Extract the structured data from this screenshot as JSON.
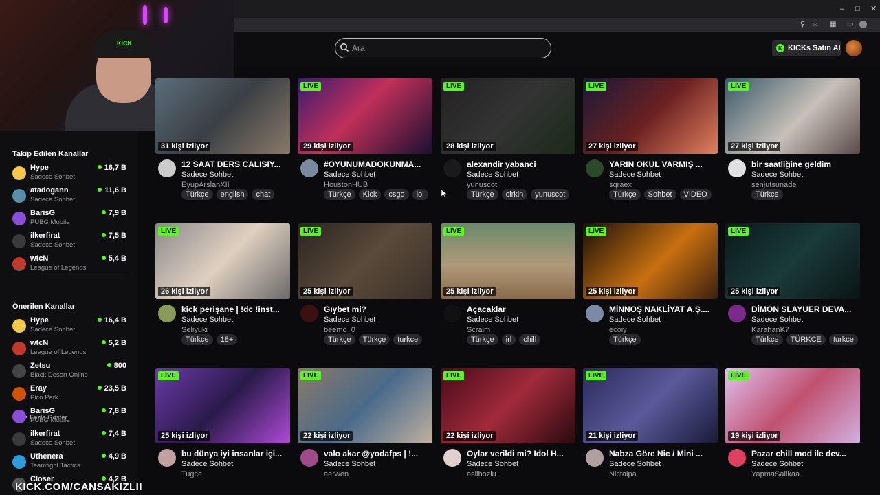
{
  "header": {
    "search_placeholder": "Ara",
    "kicks_button": "KICKs Satın Al"
  },
  "webcam": {
    "cap_text": "KICK"
  },
  "sidebar": {
    "followed_title": "Takip Edilen Kanallar",
    "followed": [
      {
        "name": "Hype",
        "category": "Sadece Sohbet",
        "viewers": "16,7 B",
        "color": "#f2c94c"
      },
      {
        "name": "atadogann",
        "category": "Sadece Sohbet",
        "viewers": "11,6 B",
        "color": "#5a8fa8"
      },
      {
        "name": "BarisG",
        "category": "PUBG Mobile",
        "viewers": "7,9 B",
        "color": "#8a4fd8"
      },
      {
        "name": "ilkerfirat",
        "category": "Sadece Sohbet",
        "viewers": "7,5 B",
        "color": "#3a3a3a"
      },
      {
        "name": "wtcN",
        "category": "League of Legends",
        "viewers": "5,4 B",
        "color": "#c0392b"
      }
    ],
    "more_label": "Daha Fazla Göster",
    "recommended_title": "Önerilen Kanallar",
    "recommended": [
      {
        "name": "Hype",
        "category": "Sadece Sohbet",
        "viewers": "16,4 B",
        "color": "#f2c94c"
      },
      {
        "name": "wtcN",
        "category": "League of Legends",
        "viewers": "5,2 B",
        "color": "#c0392b"
      },
      {
        "name": "Zetsu",
        "category": "Black Desert Online",
        "viewers": "800",
        "color": "#444"
      },
      {
        "name": "Eray",
        "category": "Pico Park",
        "viewers": "23,5 B",
        "color": "#d35400"
      },
      {
        "name": "BarisG",
        "category": "PUBG Mobile",
        "viewers": "7,8 B",
        "color": "#8a4fd8"
      },
      {
        "name": "ilkerfirat",
        "category": "Sadece Sohbet",
        "viewers": "7,4 B",
        "color": "#3a3a3a"
      },
      {
        "name": "Uthenera",
        "category": "Teamfight Tactics",
        "viewers": "4,9 B",
        "color": "#2d9cdb"
      },
      {
        "name": "Closer",
        "category": "",
        "viewers": "4,2 B",
        "color": "#555"
      }
    ]
  },
  "live_label": "LIVE",
  "streams": [
    {
      "viewers": "31 kişi izliyor",
      "title": "12 SAAT DERS CALISIY...",
      "category": "Sadece Sohbet",
      "user": "EyupArslanXII",
      "tags": [
        "Türkçe",
        "english",
        "chat"
      ],
      "live": false,
      "thumb": "linear-gradient(135deg,#5a6e7a,#3a3f44 50%,#8a7a6a)",
      "avatar": "#ccc"
    },
    {
      "viewers": "29 kişi izliyor",
      "title": "#OYUNUMADOKUNMA...",
      "category": "Sadece Sohbet",
      "user": "HoustonHUB",
      "tags": [
        "Türkçe",
        "Kick",
        "csgo",
        "lol"
      ],
      "live": true,
      "thumb": "linear-gradient(135deg,#3a1c6e,#c0305a 45%,#1a1030)",
      "avatar": "#7a8aa0"
    },
    {
      "viewers": "28 kişi izliyor",
      "title": "alexandir yabanci",
      "category": "Sadece Sohbet",
      "user": "yunuscot",
      "tags": [
        "Türkçe",
        "cirkin",
        "yunuscot"
      ],
      "live": true,
      "thumb": "linear-gradient(135deg,#222,#333 50%,#1a2a1a)",
      "avatar": "#1a1a1a"
    },
    {
      "viewers": "27 kişi izliyor",
      "title": "YARIN OKUL VARMIŞ ...",
      "category": "Sadece Sohbet",
      "user": "sqraex",
      "tags": [
        "Türkçe",
        "Sohbet",
        "VIDEO"
      ],
      "live": true,
      "thumb": "linear-gradient(135deg,#1a1a3a,#6a2020 50%,#e08060)",
      "avatar": "#2a4a2a"
    },
    {
      "viewers": "27 kişi izliyor",
      "title": "bir saatliğine geldim",
      "category": "Sadece Sohbet",
      "user": "senjutsunade",
      "tags": [
        "Türkçe"
      ],
      "live": true,
      "thumb": "linear-gradient(135deg,#3a5a6a,#c8c0b8 55%,#5a4a4a)",
      "avatar": "#e0e0e0"
    },
    {
      "viewers": "26 kişi izliyor",
      "title": "kick perişane | !dc !inst...",
      "category": "Sadece Sohbet",
      "user": "Seliyuki",
      "tags": [
        "Türkçe",
        "18+"
      ],
      "live": true,
      "thumb": "linear-gradient(135deg,#8a8a8a,#e0d0c0 50%,#6a6a6a)",
      "avatar": "#8a9a5a"
    },
    {
      "viewers": "25 kişi izliyor",
      "title": "Gıybet mi?",
      "category": "Sadece Sohbet",
      "user": "beemo_0",
      "tags": [
        "Türkçe",
        "Türkçe",
        "turkce"
      ],
      "live": true,
      "thumb": "linear-gradient(135deg,#2a2420,#5a4a3a 50%,#3a3028)",
      "avatar": "#3a1010"
    },
    {
      "viewers": "25 kişi izliyor",
      "title": "Açacaklar",
      "category": "Sadece Sohbet",
      "user": "Scraim",
      "tags": [
        "Türkçe",
        "irl",
        "chill"
      ],
      "live": true,
      "thumb": "linear-gradient(180deg,#6a8a6a,#b09a7a 55%,#8a6a4a)",
      "avatar": "#111"
    },
    {
      "viewers": "25 kişi izliyor",
      "title": "MİNNOŞ NAKLİYAT A.Ş....",
      "category": "Sadece Sohbet",
      "user": "ecoiy",
      "tags": [
        "Türkçe"
      ],
      "live": true,
      "thumb": "linear-gradient(135deg,#1a1008,#c87010 55%,#3a2010)",
      "avatar": "#7a8aa8"
    },
    {
      "viewers": "25 kişi izliyor",
      "title": "DİMON SLAYUER DEVA...",
      "category": "Sadece Sohbet",
      "user": "KarahanK7",
      "tags": [
        "Türkçe",
        "TÜRKCE",
        "turkce"
      ],
      "live": true,
      "thumb": "linear-gradient(135deg,#0a1a1a,#1a3a3a 50%,#0a1414)",
      "avatar": "#7a2a8a"
    },
    {
      "viewers": "25 kişi izliyor",
      "title": "bu dünya iyi insanlar içi...",
      "category": "Sadece Sohbet",
      "user": "Tugce",
      "tags": [],
      "live": true,
      "thumb": "linear-gradient(135deg,#6a3aa8,#2a1a4a 50%,#b04ad8)",
      "avatar": "#c0a0a0"
    },
    {
      "viewers": "22 kişi izliyor",
      "title": "valo akar @yodafps | !...",
      "category": "Sadece Sohbet",
      "user": "aerwen",
      "tags": [],
      "live": true,
      "thumb": "linear-gradient(135deg,#8a7a6a,#4a6a8a 50%,#c0b0a0)",
      "avatar": "#a04a8a"
    },
    {
      "viewers": "22 kişi izliyor",
      "title": "Oylar verildi mi? Idol H...",
      "category": "Sadece Sohbet",
      "user": "aslibozlu",
      "tags": [],
      "live": true,
      "thumb": "linear-gradient(135deg,#4a0a1a,#a02a3a 50%,#2a0a10)",
      "avatar": "#e0d0d0"
    },
    {
      "viewers": "21 kişi izliyor",
      "title": "Nabza Göre Nic / Mini ...",
      "category": "Sadece Sohbet",
      "user": "Nictalpa",
      "tags": [],
      "live": true,
      "thumb": "linear-gradient(135deg,#2a2a5a,#5a5a9a 50%,#1a1a3a)",
      "avatar": "#b0a0a0"
    },
    {
      "viewers": "19 kişi izliyor",
      "title": "Pazar chill mod ile dev...",
      "category": "Sadece Sohbet",
      "user": "YapmaSalikaa",
      "tags": [],
      "live": true,
      "thumb": "linear-gradient(135deg,#e0c0f0,#c05070 50%,#d0b0e0)",
      "avatar": "#e04060"
    }
  ],
  "watermark": "KICK.COM/CANSAKIZLII",
  "colors": {
    "accent": "#53fc18",
    "background": "#0b0b0d",
    "tag": "#2a2a2e"
  }
}
